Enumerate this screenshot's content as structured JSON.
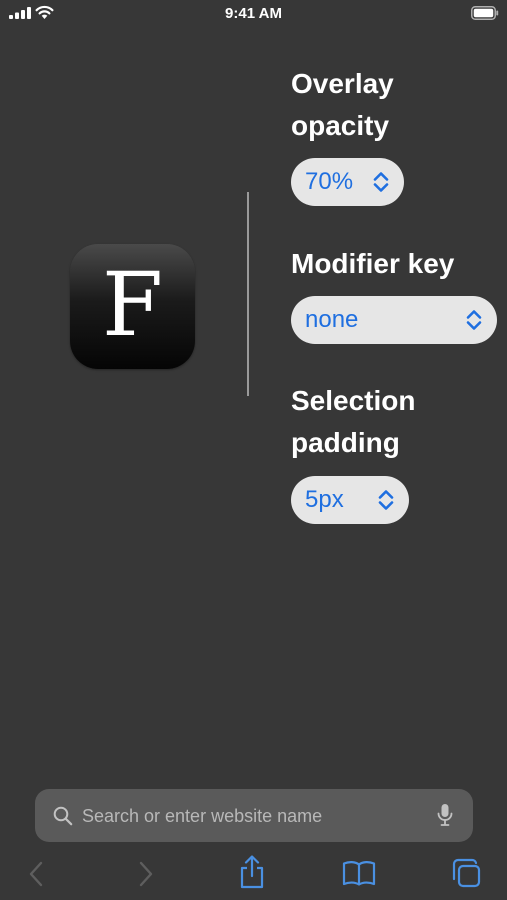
{
  "status_bar": {
    "time": "9:41 AM"
  },
  "app_icon": {
    "letter": "F"
  },
  "settings": {
    "overlay_opacity": {
      "label": "Overlay opacity",
      "value": "70%"
    },
    "modifier_key": {
      "label": "Modifier key",
      "value": "none"
    },
    "selection_padding": {
      "label": "Selection padding",
      "value": "5px"
    }
  },
  "browser": {
    "search_placeholder": "Search or enter website name"
  },
  "colors": {
    "background": "#373737",
    "accent": "#1f6fe0",
    "pill_background": "#e6e6e6",
    "toolbar_active": "#4a90e2",
    "toolbar_disabled": "#5e5e5e"
  },
  "icons": {
    "status": [
      "signal-icon",
      "wifi-icon",
      "battery-icon"
    ],
    "toolbar": [
      "back-icon",
      "forward-icon",
      "share-icon",
      "bookmarks-icon",
      "tabs-icon"
    ]
  }
}
